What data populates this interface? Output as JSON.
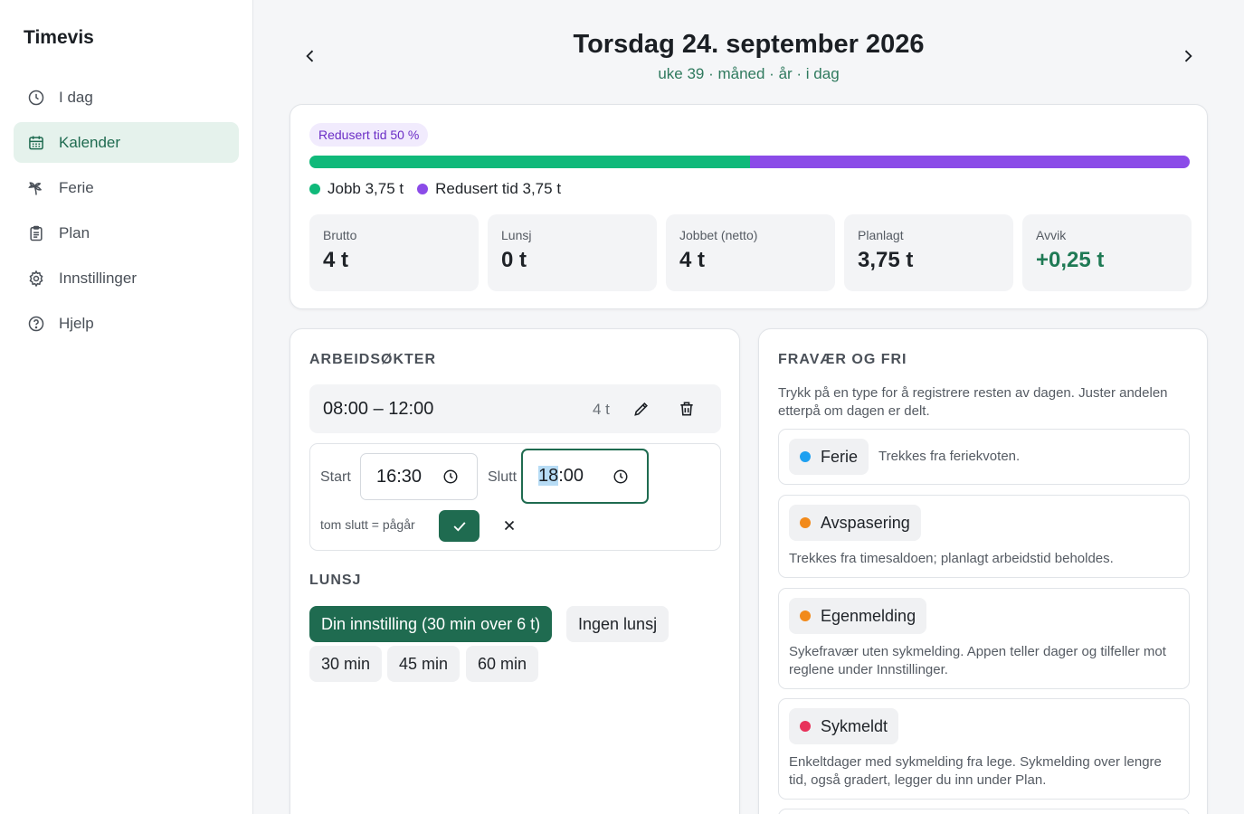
{
  "app": {
    "title": "Timevis"
  },
  "sidebar": {
    "items": [
      {
        "label": "I dag",
        "icon": "clock-icon",
        "active": false
      },
      {
        "label": "Kalender",
        "icon": "calendar-icon",
        "active": true
      },
      {
        "label": "Ferie",
        "icon": "palm-tree-icon",
        "active": false
      },
      {
        "label": "Plan",
        "icon": "clipboard-icon",
        "active": false
      },
      {
        "label": "Innstillinger",
        "icon": "gear-icon",
        "active": false
      },
      {
        "label": "Hjelp",
        "icon": "help-circle-icon",
        "active": false
      }
    ]
  },
  "header": {
    "title": "Torsdag 24. september 2026",
    "links": [
      "uke 39",
      "måned",
      "år",
      "i dag"
    ],
    "separator": " · "
  },
  "summary": {
    "badge": "Redusert tid 50 %",
    "progress": {
      "job_fraction": 0.5,
      "reduced_fraction": 0.5
    },
    "legend": [
      {
        "label": "Jobb 3,75 t",
        "color": "#10b97a"
      },
      {
        "label": "Redusert tid 3,75 t",
        "color": "#8b4be8"
      }
    ],
    "stats": [
      {
        "label": "Brutto",
        "value": "4 t"
      },
      {
        "label": "Lunsj",
        "value": "0 t"
      },
      {
        "label": "Jobbet (netto)",
        "value": "4 t"
      },
      {
        "label": "Planlagt",
        "value": "3,75 t"
      },
      {
        "label": "Avvik",
        "value": "+0,25 t"
      }
    ]
  },
  "sessions": {
    "title": "ARBEIDSØKTER",
    "row": {
      "time": "08:00 – 12:00",
      "duration": "4 t"
    },
    "edit": {
      "start_label": "Start",
      "start_value": "16:30",
      "end_label": "Slutt",
      "end_value_hour": "18",
      "end_value_rest": ":00",
      "hint": "tom slutt = pågår"
    },
    "lunch_title": "LUNSJ",
    "lunch_options": [
      "Din innstilling (30 min over 6 t)",
      "Ingen lunsj",
      "30 min",
      "45 min",
      "60 min"
    ]
  },
  "absence": {
    "title": "FRAVÆR OG FRI",
    "description": "Trykk på en type for å registrere resten av dagen. Juster andelen etterpå om dagen er delt.",
    "items": [
      {
        "label": "Ferie",
        "color": "#1ea0f0",
        "text": "Trekkes fra feriekvoten."
      },
      {
        "label": "Avspasering",
        "color": "#f28a1a",
        "text": "Trekkes fra timesaldoen; planlagt arbeidstid beholdes."
      },
      {
        "label": "Egenmelding",
        "color": "#f28a1a",
        "text": "Sykefravær uten sykmelding. Appen teller dager og tilfeller mot reglene under Innstillinger."
      },
      {
        "label": "Sykmeldt",
        "color": "#e8315a",
        "text": "Enkeltdager med sykmelding fra lege. Sykmelding over lengre tid, også gradert, legger du inn under Plan."
      }
    ]
  }
}
